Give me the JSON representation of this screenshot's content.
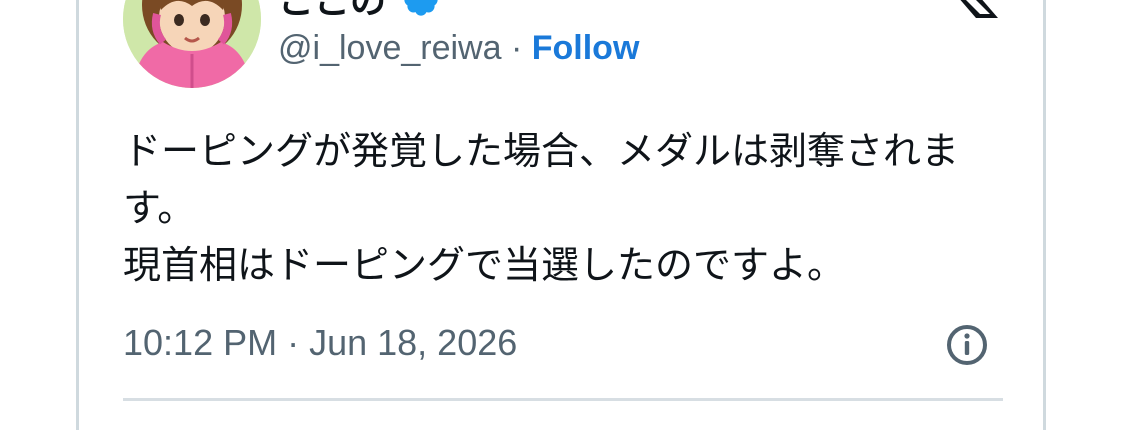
{
  "author": {
    "display_name": "ここの",
    "handle": "@i_love_reiwa",
    "separator": "·",
    "follow_label": "Follow",
    "verified_color": "#1d9bf0"
  },
  "tweet": {
    "text": "ドーピングが発覚した場合、メダルは剥奪されます。\n現首相はドーピングで当選したのですよ。",
    "timestamp": "10:12 PM · Jun 18, 2026"
  },
  "icons": {
    "brand": "x-logo-icon",
    "info": "info-icon",
    "verified": "verified-badge-icon"
  },
  "colors": {
    "accent": "#1a79d9",
    "text": "#0f1419",
    "secondary": "#536471",
    "border": "#cfd9de"
  }
}
